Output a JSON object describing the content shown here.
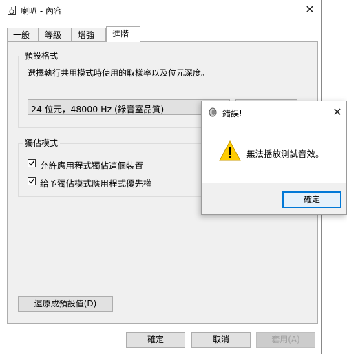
{
  "window": {
    "title": "喇叭 - 內容",
    "close_glyph": "✕"
  },
  "tabs": [
    {
      "label": "一般"
    },
    {
      "label": "等級"
    },
    {
      "label": "增強"
    },
    {
      "label": "進階"
    }
  ],
  "default_format": {
    "group_title": "預設格式",
    "description": "選擇執行共用模式時使用的取樣率以及位元深度。",
    "selected_value": "24 位元，48000 Hz (錄音室品質)"
  },
  "exclusive_mode": {
    "group_title": "獨佔模式",
    "allow_label": "允許應用程式獨佔這個裝置",
    "allow_checked": true,
    "priority_label": "給予獨佔模式應用程式優先權",
    "priority_checked": true
  },
  "restore_defaults_label": "還原成預設值(D)",
  "footer": {
    "ok_label": "確定",
    "cancel_label": "取消",
    "apply_label": "套用(A)"
  },
  "error_dialog": {
    "title": "錯誤!",
    "message": "無法播放測試音效。",
    "ok_label": "確定",
    "close_glyph": "✕",
    "icon": "warning-icon",
    "accent_color": "#0078d7",
    "warning_color": "#ffcc00"
  }
}
